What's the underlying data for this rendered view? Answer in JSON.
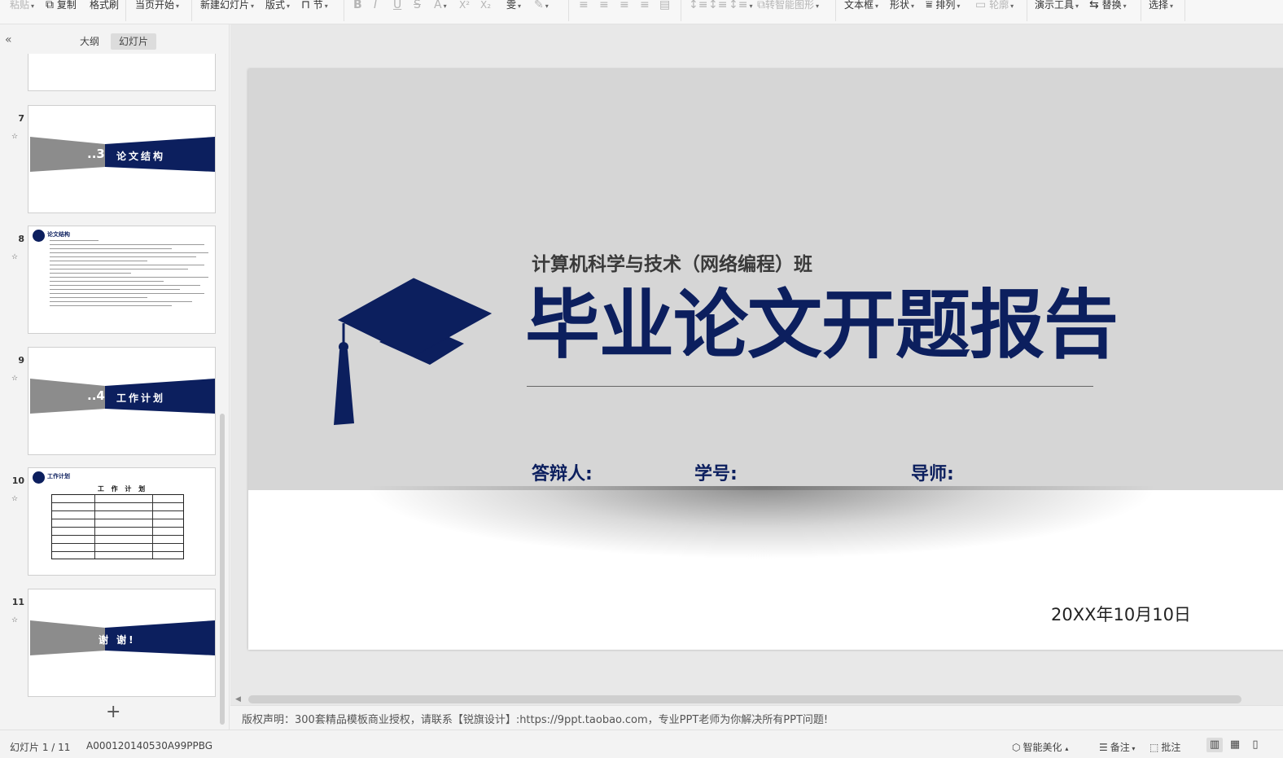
{
  "toolbar": {
    "paste": "粘贴",
    "copy": "复制",
    "format_painter": "格式刷",
    "start_from_current": "当页开始",
    "new_slide": "新建幻灯片",
    "layout": "版式",
    "section": "节",
    "bold": "B",
    "italic": "I",
    "underline": "U",
    "strike": "S",
    "font_color": "A",
    "superscript": "X²",
    "subscript": "X₂",
    "phonetic": "雯",
    "to_smart_art": "转智能图形",
    "textbox": "文本框",
    "shape": "形状",
    "arrange": "排列",
    "outline": "轮廓",
    "presentation_tools": "演示工具",
    "replace": "替换",
    "select": "选择"
  },
  "left_panel": {
    "tabs": [
      "大纲",
      "幻灯片"
    ],
    "active_tab": "幻灯片",
    "slides": [
      {
        "number": "7",
        "kind": "section",
        "num_label": "..3",
        "label": "论文结构"
      },
      {
        "number": "8",
        "kind": "content",
        "heading": "论文结构"
      },
      {
        "number": "9",
        "kind": "section",
        "num_label": "..4",
        "label": "工作计划"
      },
      {
        "number": "10",
        "kind": "table",
        "heading": "工作计划",
        "table_title": "工 作 计 划"
      },
      {
        "number": "11",
        "kind": "section",
        "num_label": "",
        "label": "谢 谢!"
      }
    ],
    "add_slide_symbol": "+"
  },
  "slide": {
    "subtitle": "计算机科学与技术（网络编程）班",
    "title": "毕业论文开题报告",
    "field_defender": "答辩人:",
    "field_student_id": "学号:",
    "field_advisor": "导师:",
    "date": "20XX年10月10日",
    "colors": {
      "navy": "#0c1f5e",
      "gray_band": "#d6d6d6"
    }
  },
  "notes": {
    "text": "版权声明：300套精品模板商业授权，请联系【锐旗设计】:https://9ppt.taobao.com，专业PPT老师为你解决所有PPT问题!"
  },
  "status": {
    "slide_counter": "幻灯片 1 / 11",
    "template_id": "A000120140530A99PPBG",
    "smart_beautify": "智能美化",
    "notes_btn": "备注",
    "comments_btn": "批注"
  }
}
